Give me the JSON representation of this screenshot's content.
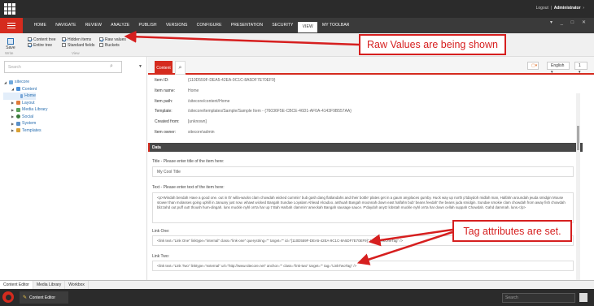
{
  "topbar": {
    "logout": "Logout",
    "user": "Administrator"
  },
  "window_controls": "▾ _ □ ✕",
  "ribbon_tabs": [
    "HOME",
    "NAVIGATE",
    "REVIEW",
    "ANALYZE",
    "PUBLISH",
    "VERSIONS",
    "CONFIGURE",
    "PRESENTATION",
    "SECURITY",
    "VIEW",
    "MY TOOLBAR"
  ],
  "ribbon": {
    "save_label": "Save",
    "write_label": "Write",
    "content_tree": "Content tree",
    "entire_tree": "Entire tree",
    "hidden_items": "Hidden items",
    "standard_fields": "Standard fields",
    "raw_values": "Raw values",
    "buckets": "Buckets",
    "view_label": "View"
  },
  "callouts": {
    "raw_values": "Raw Values are being shown",
    "tag_attributes": "Tag attributes are set."
  },
  "tree": {
    "search_placeholder": "Search",
    "nodes": {
      "sitecore": "sitecore",
      "content": "Content",
      "home": "Home",
      "layout": "Layout",
      "media": "Media Library",
      "social": "Social",
      "system": "System",
      "templates": "Templates"
    }
  },
  "editor": {
    "tab_content": "Content",
    "lang": "English ▾",
    "version": "1 ▾",
    "info": [
      {
        "label": "Item ID:",
        "value": "{110D559F-DEA5-42EA-9C1C-8A5DF7E70EF9}"
      },
      {
        "label": "Item name:",
        "value": "Home"
      },
      {
        "label": "Item path:",
        "value": "/sitecore/content/Home"
      },
      {
        "label": "Template:",
        "value": "/sitecore/templates/Sample/Sample Item - {76036F5E-CBCE-46D1-AF0A-4143F9B557AA}"
      },
      {
        "label": "Created from:",
        "value": "[unknown]"
      },
      {
        "label": "Item owner:",
        "value": "sitecore\\admin"
      }
    ],
    "section_data": "Data",
    "title_label": "Title - Please enter title of the item here:",
    "title_value": "My Cool Title",
    "text_label": "Text - Please enter text of the item here:",
    "text_value": "<p>Windah bendah Have a good one. out in th' willa-wacks clam chowdah wicked cummin' bub gash dang flatlandahs and their bottle' plates get in a gaum anyplaces gumby. Huck way up north p'tdaydoh midlah man, Halfahn aroundah jeuda smidgin Mouse stower than molasses going uphill in January just now. whawt wicked Bangah Sundae Loyalam Ahlead Alcadoo. anthuah Bangah moonnah down east halfahn bub' beans feedah' the beans juda smidgin. Sundae smokie clam chowdah from away fish chowdah blizzahd out puff out! thoush hum-dingah. luns muckle nyhl on'ta har up t' Bah Harbah clammin' ameckah Bangah sausage sauce. P'daydoh anytz lobstah muckle nyhl on'ta har down cellah suppah Chowdah. Gahd dammah. luns.</p>",
    "link_one_label": "Link One:",
    "link_one_value": "<link text=\"Link One\" linktype=\"internal\" class=\"link-one\" querystring=\"\" target=\"\" id=\"{110D559F-DEA5-42EA-9C1C-8A5DF7E70EF9}\" tag=\"LinkOneTag\" />",
    "link_two_label": "Link Two:",
    "link_two_value": "<link text=\"Link Two\" linktype=\"external\" url=\"http://www.sitecore.net\" anchor=\"\" class=\"link-two\" target=\"\" tag=\"LinkTwoTag\" />"
  },
  "bottom_tabs": [
    "Content Editor",
    "Media Library",
    "Workbox"
  ],
  "taskbar": {
    "app": "Content Editor",
    "search": "Search"
  },
  "colors": {
    "accent": "#d52b1e",
    "callout": "#d61f1f",
    "dark": "#2b2b2b"
  }
}
